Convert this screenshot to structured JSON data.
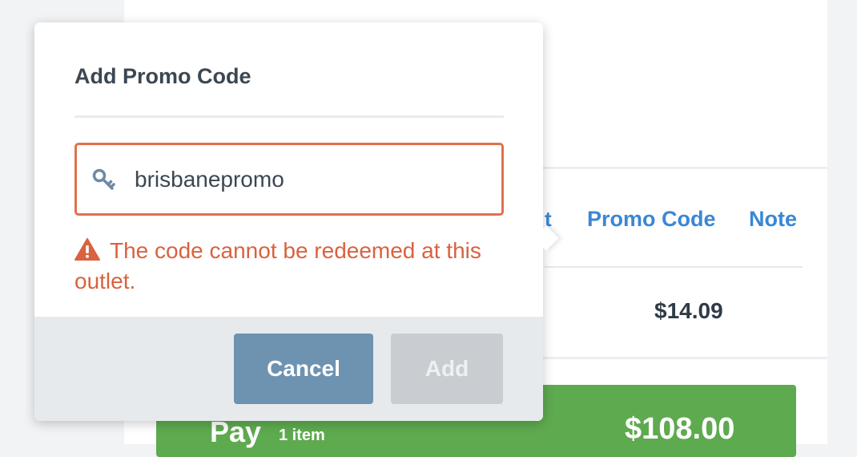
{
  "background": {
    "tabs": {
      "partial_label": "t",
      "promo_code_label": "Promo Code",
      "note_label": "Note"
    },
    "line_price": "$14.09",
    "pay": {
      "label": "Pay",
      "item_count": "1 item",
      "amount": "$108.00"
    }
  },
  "promo_popover": {
    "title": "Add Promo Code",
    "input_value": "brisbanepromo",
    "input_icon": "key-icon",
    "error": {
      "icon": "warning-icon",
      "message": "The code cannot be redeemed at this outlet."
    },
    "buttons": {
      "cancel_label": "Cancel",
      "add_label": "Add",
      "add_disabled": true
    }
  },
  "colors": {
    "link_blue": "#3a87d6",
    "error_red": "#d9623f",
    "pay_green": "#5eaa4f",
    "cancel_button": "#6e93b1",
    "add_button_disabled": "#c9cdd1"
  }
}
